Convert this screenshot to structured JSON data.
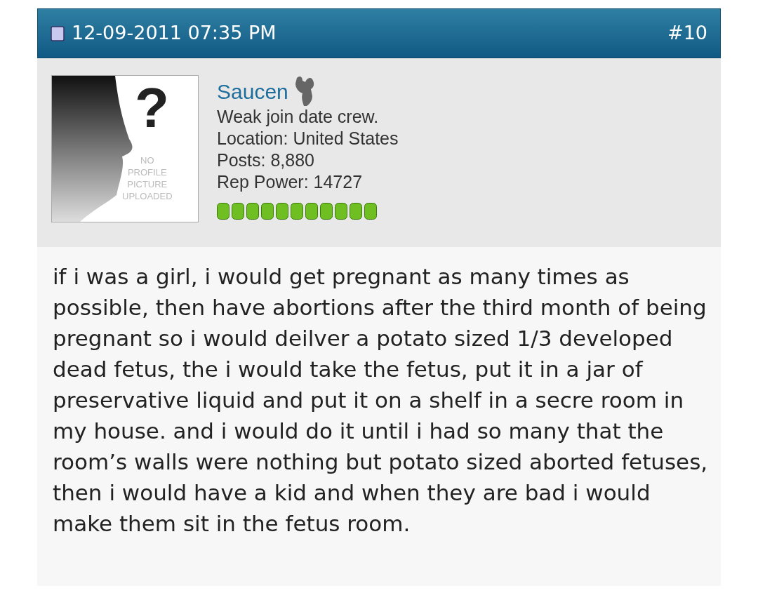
{
  "post_header": {
    "date": "12-09-2011 07:35 PM",
    "post_number": "#10"
  },
  "user": {
    "avatar": {
      "mark": "?",
      "caption": [
        "NO",
        "PROFILE",
        "PICTURE",
        "UPLOADED"
      ]
    },
    "name": "Saucen",
    "title": "Weak join date crew.",
    "location": "Location: United States",
    "posts": "Posts: 8,880",
    "rep_power": "Rep Power: 14727",
    "reputation": [
      {
        "kind": "positive"
      },
      {
        "kind": "positive"
      },
      {
        "kind": "positive"
      },
      {
        "kind": "positive"
      },
      {
        "kind": "positive"
      },
      {
        "kind": "positive"
      },
      {
        "kind": "positive"
      },
      {
        "kind": "positive"
      },
      {
        "kind": "positive"
      },
      {
        "kind": "positive"
      },
      {
        "kind": "positive"
      }
    ]
  },
  "message": "if i was a girl, i would get pregnant as many times as possible, then have abortions after the third month of being pregnant so i would deilver a potato sized 1/3 developed dead fetus, the i would take the fetus, put it in a jar of preservative liquid and put it on a shelf in a secre room in my house. and i would do it until i had so many that the room’s walls were nothing but potato sized aborted fetuses, then i would have a kid and when they are bad i would make them sit in the fetus room."
}
